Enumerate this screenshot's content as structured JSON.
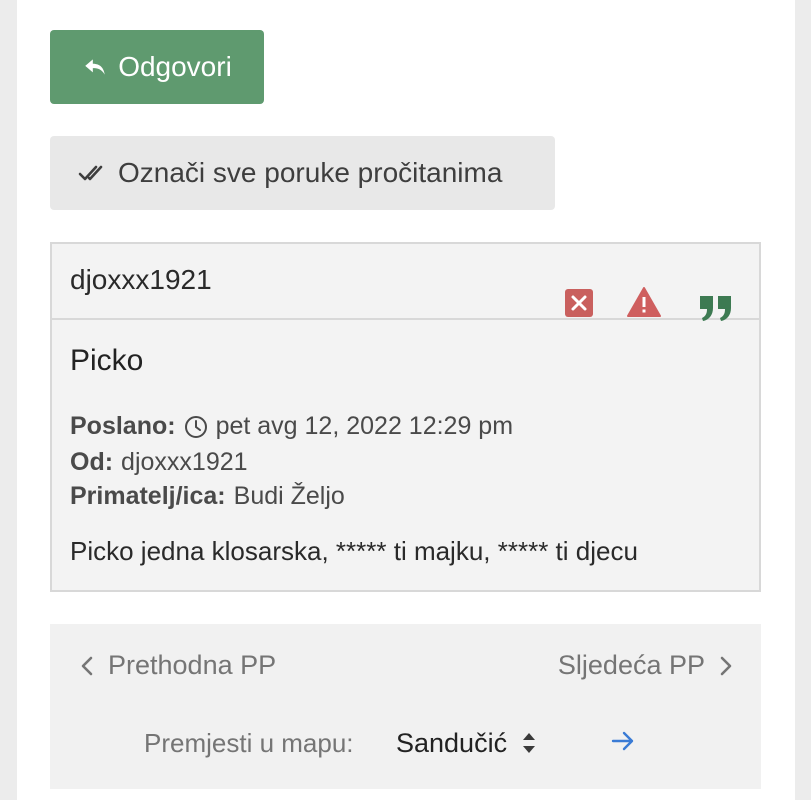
{
  "actions": {
    "reply_label": "Odgovori",
    "mark_read_label": "Označi sve poruke pročitanima"
  },
  "message": {
    "author": "djoxxx1921",
    "title": "Picko",
    "sent_label": "Poslano:",
    "sent_value": "pet avg 12, 2022 12:29 pm",
    "from_label": "Od:",
    "from_value": "djoxxx1921",
    "to_label": "Primatelj/ica:",
    "to_value": "Budi Željo",
    "body": "Picko jedna klosarska, ***** ti majku, ***** ti djecu",
    "icons": [
      "delete-icon",
      "report-icon",
      "quote-icon"
    ]
  },
  "navigation": {
    "prev_label": "Prethodna PP",
    "next_label": "Sljedeća PP",
    "move_label": "Premjesti u mapu:",
    "folder_value": "Sandučić"
  },
  "colors": {
    "reply_button": "#5f9a6f",
    "delete": "#c9605e",
    "report": "#cf5f5f",
    "quote": "#3d7a52",
    "go_arrow": "#3a7bd5"
  }
}
